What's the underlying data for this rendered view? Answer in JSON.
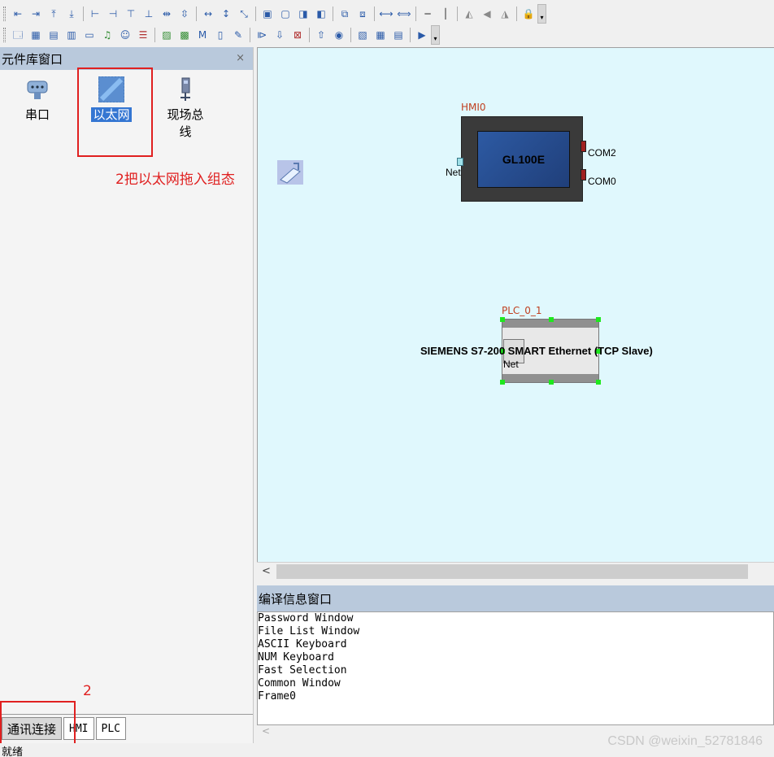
{
  "toolbar1": {
    "groups": [
      [
        "align-left-icon",
        "align-right-icon",
        "align-top-icon",
        "align-bottom-icon"
      ],
      [
        "align-h-icon",
        "align-v-icon",
        "align-center-icon",
        "align-middle-icon",
        "dist-h-icon",
        "dist-v-icon"
      ],
      [
        "same-width-icon",
        "same-height-icon",
        "same-size-icon"
      ],
      [
        "bring-front-icon",
        "send-back-icon",
        "forward-icon",
        "backward-icon"
      ],
      [
        "group-icon",
        "ungroup-icon"
      ],
      [
        "space-h-icon",
        "space-v-icon"
      ],
      [
        "hline-icon",
        "vline-icon"
      ],
      [
        "flip-icon",
        "rotate-left-icon",
        "rotate-right-icon"
      ],
      [
        "lock-icon"
      ]
    ]
  },
  "toolbar2": {
    "groups": [
      [
        "window-icon",
        "grid-icon",
        "layout-icon",
        "keypad-icon",
        "folder-icon",
        "music-icon",
        "user-icon",
        "stack-icon"
      ],
      [
        "image-icon",
        "picture-icon",
        "m-icon",
        "doc-icon",
        "tool-icon"
      ],
      [
        "compile-icon",
        "download-icon",
        "clear-icon"
      ],
      [
        "upload-icon",
        "sim-icon"
      ],
      [
        "chart-icon",
        "table-icon",
        "report-icon"
      ],
      [
        "run-icon"
      ]
    ]
  },
  "library": {
    "title": "元件库窗口",
    "close": "×",
    "items": [
      {
        "label": "串口",
        "icon": "serial-port-icon"
      },
      {
        "label": "以太网",
        "icon": "ethernet-icon"
      },
      {
        "label": "现场总线",
        "icon": "fieldbus-icon"
      }
    ],
    "annotation_drag": "2把以太网拖入组态",
    "annotation_step": "2",
    "tabs": [
      "通讯连接",
      "HMI",
      "PLC"
    ]
  },
  "canvas": {
    "hmi": {
      "name": "HMI0",
      "model": "GL100E",
      "net_label": "Net",
      "com2_label": "COM2",
      "com0_label": "COM0"
    },
    "plc": {
      "name": "PLC_0_1",
      "device": "SIEMENS S7-200 SMART Ethernet (TCP Slave)",
      "net_label": "Net"
    },
    "scroll_left": "<"
  },
  "output": {
    "title": "编译信息窗口",
    "lines": [
      "Password Window",
      "File List Window",
      "ASCII Keyboard",
      "NUM Keyboard",
      "Fast Selection",
      "Common Window",
      "Frame0"
    ],
    "scroll_left": "<"
  },
  "status": "就绪",
  "watermark": "CSDN @weixin_52781846",
  "colors": {
    "title_bar": "#b9c9dc",
    "canvas_bg": "#e0f8fd",
    "annotation": "#e02020",
    "selection_handle": "#1ee81e",
    "highlight": "#3476d2"
  }
}
